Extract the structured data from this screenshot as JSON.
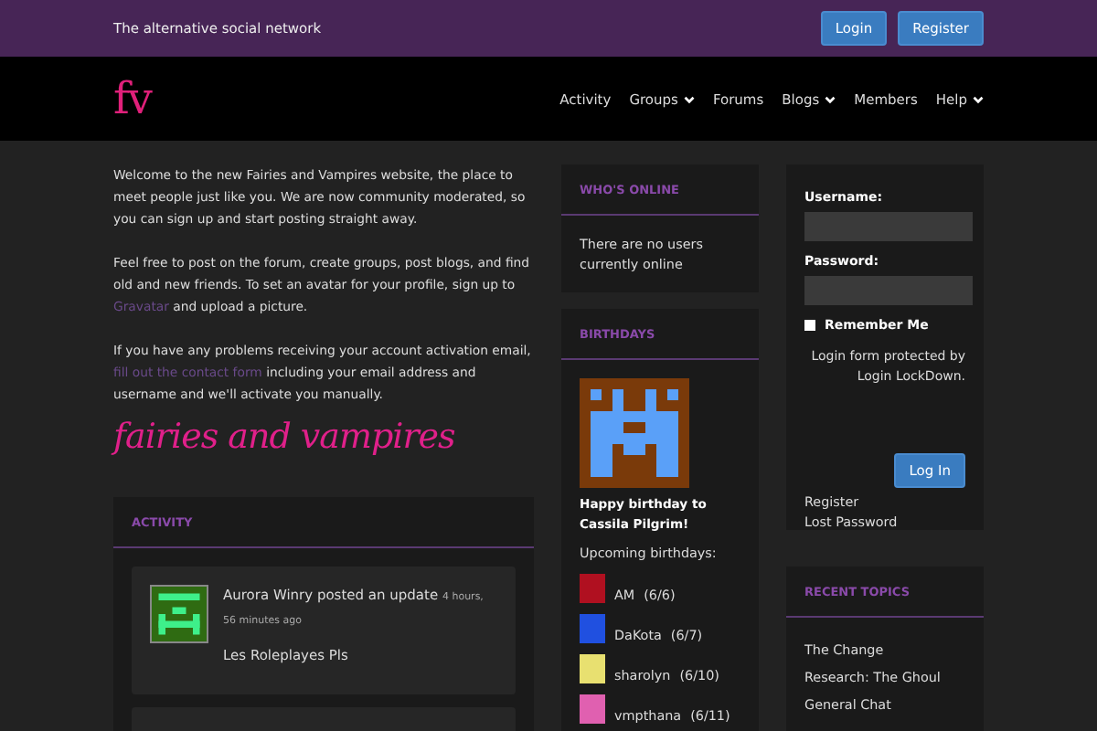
{
  "top_bar": {
    "tagline": "The alternative social network",
    "buttons": [
      "Login",
      "Register"
    ]
  },
  "nav": {
    "logo": "fv",
    "items": [
      {
        "label": "Activity",
        "dropdown": false
      },
      {
        "label": "Groups",
        "dropdown": true
      },
      {
        "label": "Forums",
        "dropdown": false
      },
      {
        "label": "Blogs",
        "dropdown": true
      },
      {
        "label": "Members",
        "dropdown": false
      },
      {
        "label": "Help",
        "dropdown": true
      }
    ]
  },
  "intro": {
    "paragraphs": [
      [
        {
          "text": "Welcome to the new Fairies and Vampires website, the place to meet people just like you. We are now community moderated, so you can sign up and start posting straight away.",
          "link": false
        }
      ],
      [
        {
          "text": "Feel free to post on the forum, create groups, post blogs, and find old and new friends. To set an avatar for your profile, sign up to ",
          "link": false
        },
        {
          "text": "Gravatar",
          "link": true
        },
        {
          "text": " and upload a picture.",
          "link": false
        }
      ],
      [
        {
          "text": "If you have any problems receiving your account activation email, ",
          "link": false
        },
        {
          "text": "fill out the contact form",
          "link": true
        },
        {
          "text": " including your email address and username and we'll activate you manually.",
          "link": false
        }
      ]
    ],
    "banner": "fairies and vampires"
  },
  "activity": {
    "title": "ACTIVITY",
    "items": [
      {
        "author": "Aurora Winry",
        "action": " posted an update",
        "time": "4 hours, 56 minutes ago",
        "content": "Les Roleplayes Pls"
      }
    ]
  },
  "whos_online": {
    "title": "WHO'S ONLINE",
    "text": "There are no users currently online"
  },
  "birthdays": {
    "title": "BIRTHDAYS",
    "greeting": "Happy birthday to Cassila Pilgrim!",
    "upcoming_label": "Upcoming birthdays:",
    "upcoming": [
      {
        "name": "AM",
        "date": "(6/6)",
        "color": "#b01020"
      },
      {
        "name": "DaKota",
        "date": "(6/7)",
        "color": "#2050e0"
      },
      {
        "name": "sharolyn",
        "date": "(6/10)",
        "color": "#e8e070"
      },
      {
        "name": "vmpthana",
        "date": "(6/11)",
        "color": "#e060b0"
      }
    ]
  },
  "login": {
    "username_label": "Username:",
    "password_label": "Password:",
    "remember": {
      "label": "Remember Me",
      "checked": false
    },
    "note": "Login form protected by Login LockDown.",
    "submit": "Log In",
    "links": [
      "Register",
      "Lost Password"
    ]
  },
  "recent_topics": {
    "title": "RECENT TOPICS",
    "topics": [
      "The Change",
      "Research: The Ghoul",
      "General Chat"
    ]
  }
}
